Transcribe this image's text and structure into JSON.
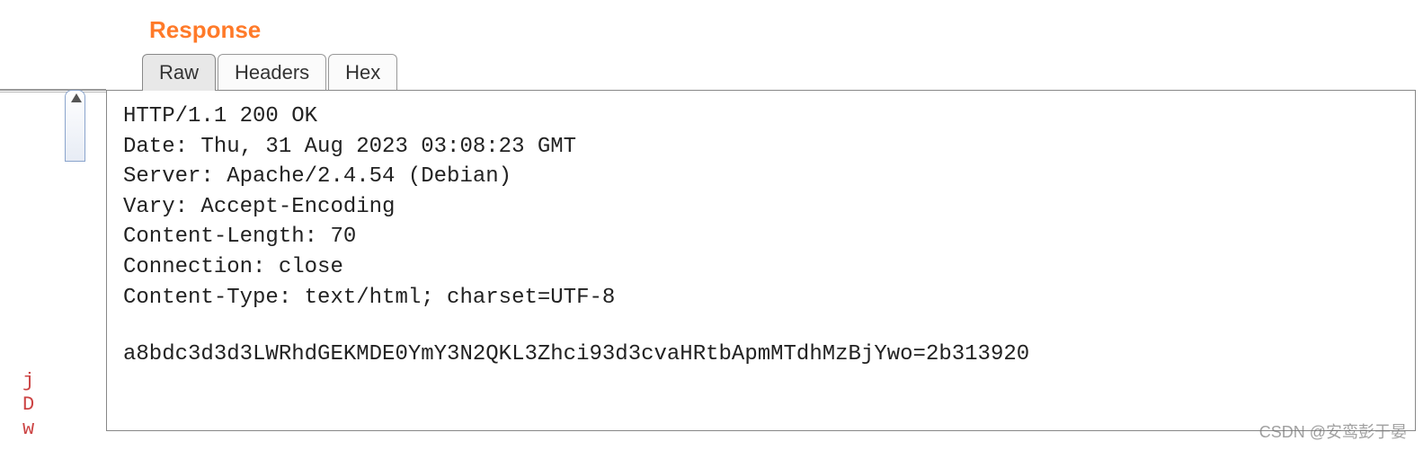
{
  "panel": {
    "title": "Response"
  },
  "tabs": {
    "raw": "Raw",
    "headers": "Headers",
    "hex": "Hex"
  },
  "response": {
    "status_line": "HTTP/1.1 200 OK",
    "header_date": "Date: Thu, 31 Aug 2023 03:08:23 GMT",
    "header_server": "Server: Apache/2.4.54 (Debian)",
    "header_vary": "Vary: Accept-Encoding",
    "header_content_length": "Content-Length: 70",
    "header_connection": "Connection: close",
    "header_content_type": "Content-Type: text/html; charset=UTF-8",
    "body": "a8bdc3d3d3LWRhdGEKMDE0YmY3N2QKL3Zhci93d3cvaHRtbApmMTdhMzBjYwo=2b313920"
  },
  "left_fragment": {
    "l1": "j",
    "l2": "D",
    "l3": "w"
  },
  "watermark": "CSDN @安鸾彭于晏"
}
